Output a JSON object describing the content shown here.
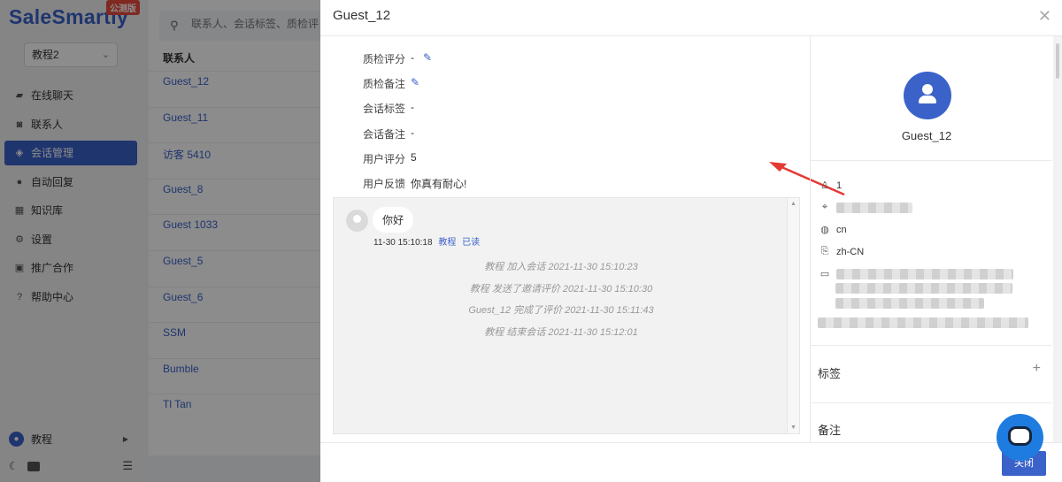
{
  "sidebar": {
    "logo": "SaleSmartly",
    "badge": "公测版",
    "workspace": "教程2",
    "nav": [
      {
        "label": "在线聊天",
        "icon": "chat-icon",
        "active": false
      },
      {
        "label": "联系人",
        "icon": "contacts-icon",
        "active": false
      },
      {
        "label": "会话管理",
        "icon": "layers-icon",
        "active": true
      },
      {
        "label": "自动回复",
        "icon": "robot-icon",
        "active": false
      },
      {
        "label": "知识库",
        "icon": "book-icon",
        "active": false
      },
      {
        "label": "设置",
        "icon": "gear-icon",
        "active": false
      },
      {
        "label": "推广合作",
        "icon": "gift-icon",
        "active": false
      },
      {
        "label": "帮助中心",
        "icon": "help-icon",
        "active": false
      }
    ],
    "user_name": "教程"
  },
  "contacts": {
    "search_placeholder": "联系人、会话标签、质检评",
    "header": "联系人",
    "items": [
      "Guest_12",
      "Guest_11",
      "访客 5410",
      "Guest_8",
      "Guest 1033",
      "Guest_5",
      "Guest_6",
      "SSM",
      "Bumble",
      "Tl Tan"
    ]
  },
  "modal": {
    "title": "Guest_12",
    "fields": [
      {
        "label": "质检评分",
        "value": "-",
        "editable": true
      },
      {
        "label": "质检备注",
        "value": "",
        "editable": true
      },
      {
        "label": "会话标签",
        "value": "-",
        "editable": false
      },
      {
        "label": "会话备注",
        "value": "-",
        "editable": false
      },
      {
        "label": "用户评分",
        "value": "5",
        "editable": false
      },
      {
        "label": "用户反馈",
        "value": "你真有耐心!",
        "editable": false
      }
    ],
    "chat": {
      "message": "你好",
      "time": "11-30 15:10:18",
      "agent": "教程",
      "status": "已读",
      "events": [
        {
          "actor": "教程",
          "text": " 加入会话 2021-11-30 15:10:23"
        },
        {
          "actor": "教程",
          "text": " 发送了邀请评价 2021-11-30 15:10:30"
        },
        {
          "actor": "Guest_12",
          "text": " 完成了评价 2021-11-30 15:11:43"
        },
        {
          "actor": "教程",
          "text": " 结束会话 2021-11-30 15:12:01"
        }
      ]
    },
    "profile": {
      "name": "Guest_12",
      "visits": "1",
      "language_code": "cn",
      "locale": "zh-CN",
      "tag_label": "标签",
      "note_label": "备注"
    },
    "close_button": "关闭"
  },
  "colors": {
    "accent": "#3a62c9",
    "arrow": "#e53935"
  }
}
